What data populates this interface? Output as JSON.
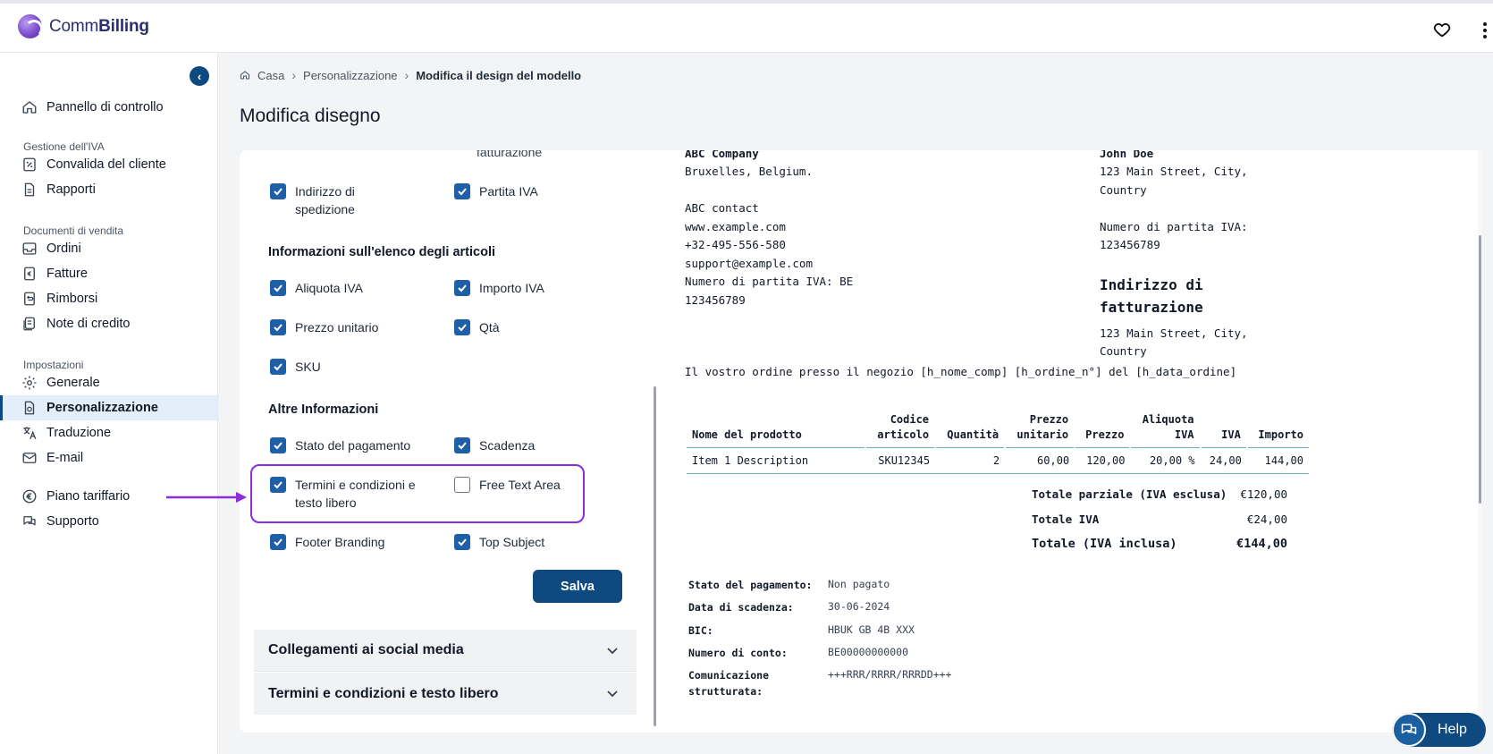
{
  "app": {
    "logo_text_prefix": "Comm",
    "logo_text_suffix": "Billing"
  },
  "sidebar": {
    "items": {
      "dashboard": "Pannello di controllo",
      "customer_validation": "Convalida del cliente",
      "reports": "Rapporti",
      "orders": "Ordini",
      "invoices": "Fatture",
      "refunds": "Rimborsi",
      "credit_notes": "Note di credito",
      "general": "Generale",
      "personalization": "Personalizzazione",
      "translation": "Traduzione",
      "email": "E-mail",
      "plan": "Piano tariffario",
      "support": "Supporto"
    },
    "sections": {
      "vat": "Gestione dell'IVA",
      "sales_docs": "Documenti di vendita",
      "settings": "Impostazioni"
    }
  },
  "breadcrumb": {
    "home": "Casa",
    "parent": "Personalizzazione",
    "current": "Modifica il design del modello"
  },
  "page_title": "Modifica disegno",
  "form": {
    "cut_off_label": "fatturazione",
    "shipping_address": "Indirizzo di spedizione",
    "vat_number": "Partita IVA",
    "items_section": "Informazioni sull'elenco degli articoli",
    "vat_rate": "Aliquota IVA",
    "vat_amount": "Importo IVA",
    "unit_price": "Prezzo unitario",
    "qty": "Qtà",
    "sku": "SKU",
    "other_section": "Altre Informazioni",
    "payment_status": "Stato del pagamento",
    "due_date": "Scadenza",
    "terms": "Termini e condizioni e testo libero",
    "free_text": "Free Text Area",
    "footer_branding": "Footer Branding",
    "top_subject": "Top Subject",
    "save": "Salva",
    "acc_social": "Collegamenti ai social media",
    "acc_terms": "Termini e condizioni e testo libero"
  },
  "preview": {
    "company": "ABC Company",
    "company_city": "Bruxelles, Belgium.",
    "contact": "ABC contact",
    "website": "www.example.com",
    "phone": "+32-495-556-580",
    "email": "support@example.com",
    "vat_line1": "Numero di partita IVA: BE",
    "vat_line2": "123456789",
    "customer": "John Doe",
    "cust_addr1": "123 Main Street, City,",
    "cust_addr2": "Country",
    "cust_vat1": "Numero di partita IVA:",
    "cust_vat2": "123456789",
    "billing_h1": "Indirizzo di",
    "billing_h2": "fatturazione",
    "bill_addr1": "123 Main Street, City,",
    "bill_addr2": "Country",
    "order_line": "Il vostro ordine presso il negozio [h_nome_comp] [h_ordine_n°] del [h_data_ordine]",
    "table": {
      "headers": {
        "name": "Nome del prodotto",
        "code1": "Codice",
        "code2": "articolo",
        "qty": "Quantità",
        "price1": "Prezzo",
        "price2": "unitario",
        "price": "Prezzo",
        "rate1": "Aliquota",
        "rate2": "IVA",
        "vat": "IVA",
        "amount": "Importo"
      },
      "row": {
        "name": "Item 1 Description",
        "code": "SKU12345",
        "qty": "2",
        "unit": "60,00",
        "price": "120,00",
        "rate": "20,00 %",
        "vat": "24,00",
        "amount": "144,00"
      }
    },
    "totals": {
      "sub_label": "Totale parziale (IVA esclusa)",
      "sub_val": "€120,00",
      "vat_label": "Totale IVA",
      "vat_val": "€24,00",
      "total_label": "Totale (IVA inclusa)",
      "total_val": "€144,00"
    },
    "payment": {
      "status_label": "Stato del pagamento:",
      "status_val": "Non pagato",
      "due_label": "Data di scadenza:",
      "due_val": "30-06-2024",
      "bic_label": "BIC:",
      "bic_val": "HBUK GB 4B XXX",
      "acct_label": "Numero di conto:",
      "acct_val": "BE00000000000",
      "comm_label1": "Comunicazione",
      "comm_label2": "strutturata:",
      "comm_val": "+++RRR/RRRR/RRRDD+++"
    }
  },
  "help": {
    "label": "Help"
  },
  "colors": {
    "primary": "#0e4a7f",
    "checkbox": "#1f5fa8",
    "highlight": "#8b2be2"
  }
}
